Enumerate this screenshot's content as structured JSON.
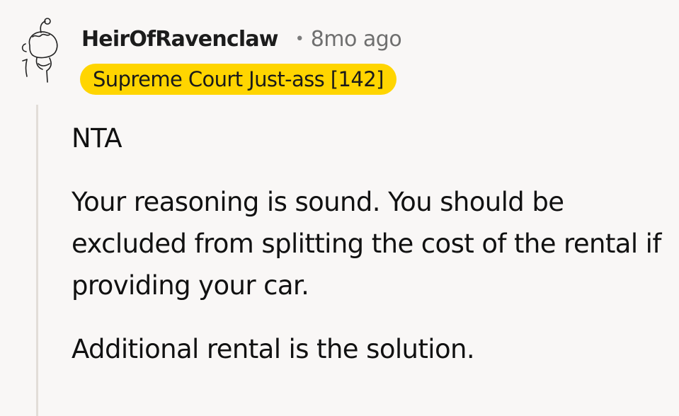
{
  "comment": {
    "author": "HeirOfRavenclaw",
    "separator": "•",
    "timestamp": "8mo ago",
    "flair": "Supreme Court Just-ass [142]",
    "paragraphs": [
      "NTA",
      "Your reasoning is sound. You should be excluded from splitting the cost of the rental if providing your car.",
      "Additional rental is the solution."
    ]
  },
  "colors": {
    "background": "#f9f7f6",
    "flair_background": "#ffd500",
    "thread_line": "#e2ddd8",
    "timestamp": "#6f6f6f"
  },
  "icons": {
    "avatar": "snoo-sketch-avatar"
  }
}
